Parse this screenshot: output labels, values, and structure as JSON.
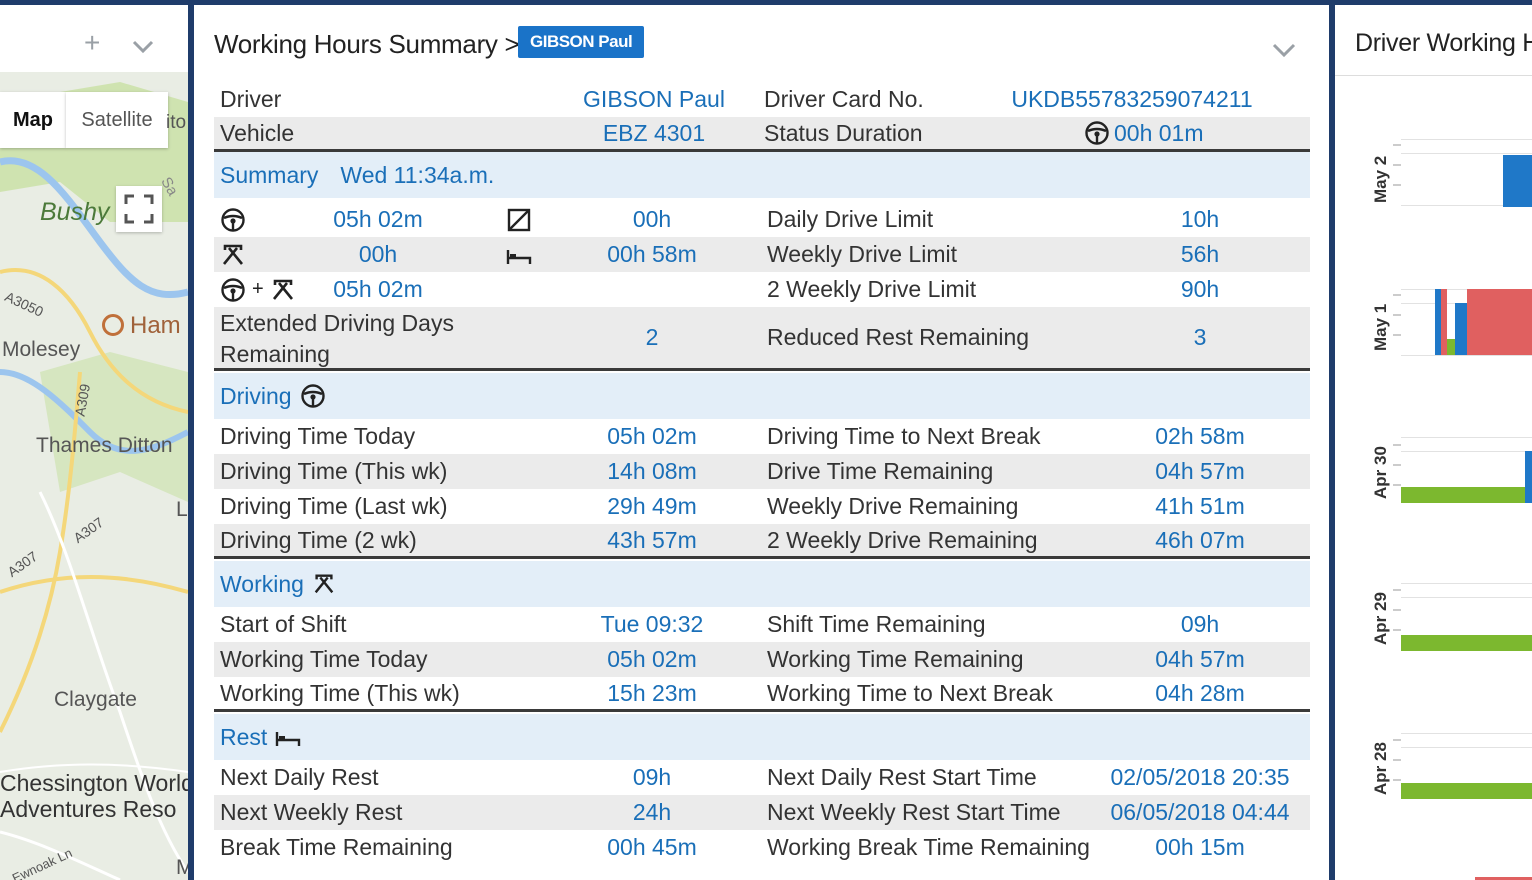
{
  "map": {
    "tabs": [
      "Map",
      "Satellite"
    ],
    "labels": [
      "Bushy",
      "Ham",
      "Molesey",
      "Thames Ditton",
      "Claygate",
      "Chessington World",
      "Adventures Reso",
      "A3050",
      "A309",
      "A307",
      "A307",
      "Ewnoak Ln",
      "ito",
      "L",
      "M",
      "Sa"
    ],
    "plus": "+"
  },
  "panel": {
    "title": "Working Hours Summary >",
    "badge": "GIBSON Paul"
  },
  "info": {
    "rows": [
      {
        "l1": "Driver",
        "v1": "GIBSON Paul",
        "l2": "Driver Card No.",
        "v2": "UKDB55783259074211"
      },
      {
        "l1": "Vehicle",
        "v1": "EBZ 4301",
        "l2": "Status Duration",
        "v2": "00h 01m"
      }
    ]
  },
  "summary": {
    "heading": "Summary",
    "time": "Wed 11:34a.m.",
    "rows": [
      {
        "v1": "05h 02m",
        "v2": "00h",
        "l": "Daily Drive Limit",
        "v3": "10h"
      },
      {
        "v1": "00h",
        "v2": "00h 58m",
        "l": "Weekly Drive Limit",
        "v3": "56h"
      },
      {
        "plus": "+",
        "v1": "05h 02m",
        "l": "2 Weekly Drive Limit",
        "v3": "90h"
      }
    ],
    "ext_label": "Extended Driving Days Remaining",
    "ext_value": "2",
    "reduced_label": "Reduced Rest Remaining",
    "reduced_value": "3"
  },
  "driving": {
    "heading": "Driving",
    "rows": [
      {
        "l1": "Driving Time Today",
        "v1": "05h 02m",
        "l2": "Driving Time to Next Break",
        "v2": "02h 58m"
      },
      {
        "l1": "Driving Time (This wk)",
        "v1": "14h 08m",
        "l2": "Drive Time Remaining",
        "v2": "04h 57m"
      },
      {
        "l1": "Driving Time (Last wk)",
        "v1": "29h 49m",
        "l2": "Weekly Drive Remaining",
        "v2": "41h 51m"
      },
      {
        "l1": "Driving Time (2 wk)",
        "v1": "43h 57m",
        "l2": "2 Weekly Drive Remaining",
        "v2": "46h 07m"
      }
    ]
  },
  "working": {
    "heading": "Working",
    "rows": [
      {
        "l1": "Start of Shift",
        "v1": "Tue 09:32",
        "l2": "Shift Time Remaining",
        "v2": "09h"
      },
      {
        "l1": "Working Time Today",
        "v1": "05h 02m",
        "l2": "Working Time Remaining",
        "v2": "04h 57m"
      },
      {
        "l1": "Working Time (This wk)",
        "v1": "15h 23m",
        "l2": "Working Time to Next Break",
        "v2": "04h 28m"
      }
    ]
  },
  "rest": {
    "heading": "Rest",
    "rows": [
      {
        "l1": "Next Daily Rest",
        "v1": "09h",
        "l2": "Next Daily Rest Start Time",
        "v2": "02/05/2018 20:35"
      },
      {
        "l1": "Next Weekly Rest",
        "v1": "24h",
        "l2": "Next Weekly Rest Start Time",
        "v2": "06/05/2018 04:44"
      },
      {
        "l1": "Break Time Remaining",
        "v1": "00h 45m",
        "l2": "Working Break Time Remaining",
        "v2": "00h 15m"
      }
    ]
  },
  "right": {
    "title": "Driver Working H",
    "dates": [
      "May 2",
      "May 1",
      "Apr 30",
      "Apr 29",
      "Apr 28"
    ]
  },
  "colors": {
    "nav": "#1f3c6b",
    "link": "#1a6fb8",
    "badge": "#1a73c8",
    "section_bg": "#e3eef8",
    "drive_bar": "#1f78c8",
    "rest_bar": "#e06060",
    "work_bar": "#7cb82f"
  },
  "icons": {
    "driving": "steering-wheel-icon",
    "working": "hammers-icon",
    "availability": "availability-box-icon",
    "rest": "bed-icon"
  }
}
